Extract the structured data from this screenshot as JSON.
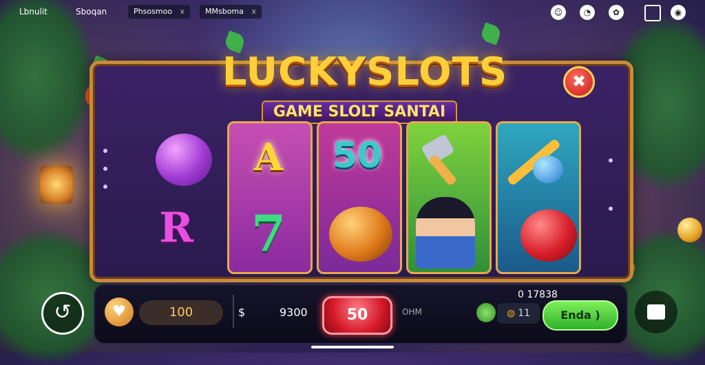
{
  "topbar": {
    "left_label": "Lbnulit",
    "section": "Sboqan",
    "pill_1": "Phsosmoo",
    "pill_1_close": "x",
    "pill_2": "MMsboma",
    "pill_2_close": "x",
    "icons": [
      "emoji-icon",
      "chart-icon",
      "settings-icon",
      "window-icon",
      "record-icon"
    ]
  },
  "game": {
    "title": "LUCKYSLOTS",
    "subtitle": "GAME SLOLT SANTAI",
    "close_symbol": "✖"
  },
  "reels": {
    "symbol_a": "A",
    "symbol_50": "50",
    "symbol_7": "7",
    "symbol_r": "R"
  },
  "controls": {
    "heart_icon": "♥",
    "bet_value": "100",
    "currency_symbol": "$",
    "balance": "9300",
    "spin_label": "50",
    "unit_label": "OHM",
    "total_label": "0 17838",
    "win_value": "11",
    "win_icon": "◍",
    "auto_label": "Enda )",
    "back_icon": "↺"
  },
  "colors": {
    "accent_gold": "#ffcf3a",
    "spin_red": "#d41a2a",
    "auto_green": "#2fb12a",
    "frame_gold": "#c98a3a"
  }
}
